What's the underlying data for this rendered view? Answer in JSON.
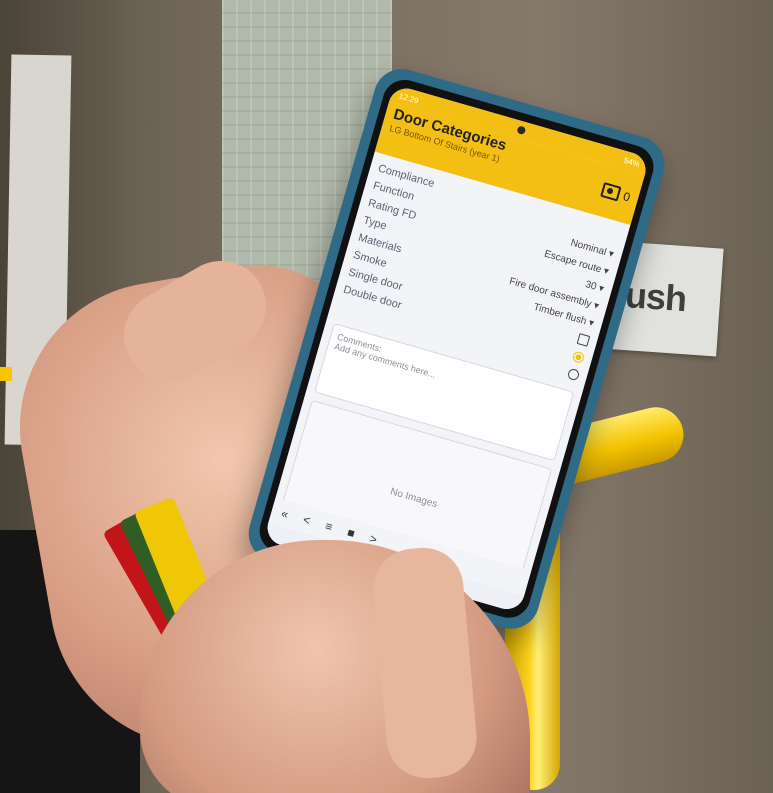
{
  "sign": {
    "text": "Push"
  },
  "status_bar": {
    "time": "12:29",
    "right": "54%"
  },
  "app": {
    "title": "Door Categories",
    "subtitle": "LG Bottom Of Stairs (year 1)",
    "photo_count": "0"
  },
  "fields": [
    {
      "label": "Compliance",
      "value": ""
    },
    {
      "label": "Function",
      "value": "Nominal ▾"
    },
    {
      "label": "Rating FD",
      "value": "Escape route ▾"
    },
    {
      "label": "Type",
      "value": "30 ▾"
    },
    {
      "label": "Materials",
      "value": "Fire door assembly ▾"
    },
    {
      "label": "Smoke",
      "value": "Timber flush ▾"
    },
    {
      "label": "Single door",
      "value": ""
    },
    {
      "label": "Double door",
      "value": ""
    }
  ],
  "comments": {
    "label": "Comments:",
    "placeholder": "Add any comments here..."
  },
  "images": {
    "empty_text": "No Images"
  },
  "toolbar": {
    "first": "«",
    "prev": "<",
    "list": "≡",
    "stop": "■",
    "next": ">"
  },
  "navbar": {
    "back": "<"
  }
}
